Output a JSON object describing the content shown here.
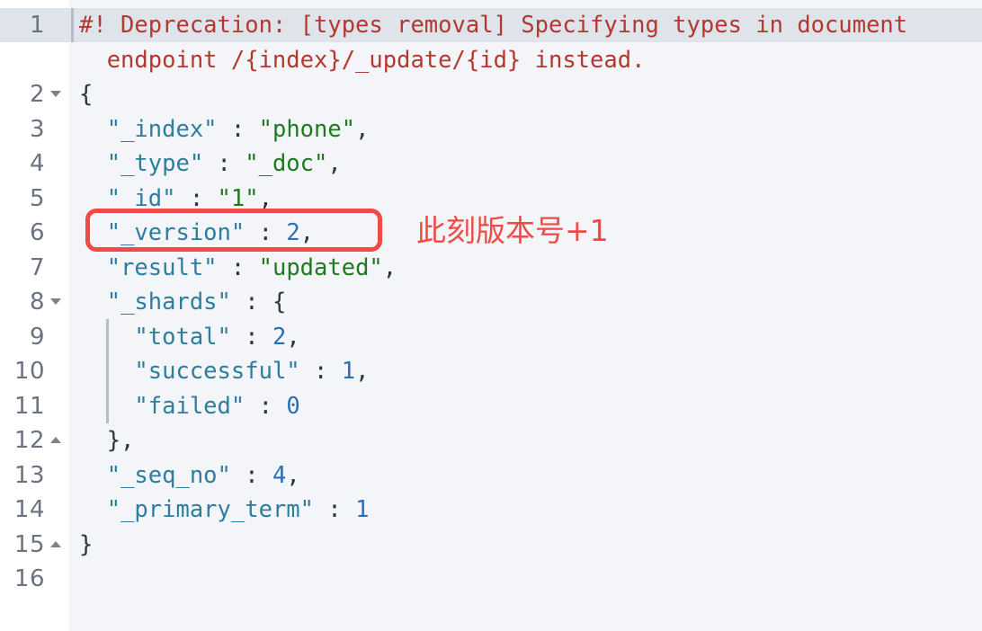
{
  "editor": {
    "language": "json",
    "background": "#f4f5f9",
    "gutter_background": "#ffffff",
    "active_line_background": "#dfe3ea",
    "total_lines": 16,
    "active_line": 1,
    "lines": [
      {
        "number": "1",
        "fold": "",
        "active": true,
        "segments": [
          {
            "text": "#! Deprecation: [types removal] Specifying types in document",
            "cls": "warn"
          }
        ]
      },
      {
        "number": "",
        "fold": "",
        "active": false,
        "segments": [
          {
            "text": "  endpoint /{index}/_update/{id} instead.",
            "cls": "warn"
          }
        ]
      },
      {
        "number": "2",
        "fold": "down",
        "active": false,
        "segments": [
          {
            "text": "{",
            "cls": "pun"
          }
        ]
      },
      {
        "number": "3",
        "fold": "",
        "active": false,
        "segments": [
          {
            "text": "  ",
            "cls": "pun"
          },
          {
            "text": "\"_index\"",
            "cls": "k"
          },
          {
            "text": " : ",
            "cls": "pun"
          },
          {
            "text": "\"phone\"",
            "cls": "str"
          },
          {
            "text": ",",
            "cls": "pun"
          }
        ]
      },
      {
        "number": "4",
        "fold": "",
        "active": false,
        "segments": [
          {
            "text": "  ",
            "cls": "pun"
          },
          {
            "text": "\"_type\"",
            "cls": "k"
          },
          {
            "text": " : ",
            "cls": "pun"
          },
          {
            "text": "\"_doc\"",
            "cls": "str"
          },
          {
            "text": ",",
            "cls": "pun"
          }
        ]
      },
      {
        "number": "5",
        "fold": "",
        "active": false,
        "segments": [
          {
            "text": "  ",
            "cls": "pun"
          },
          {
            "text": "\"_id\"",
            "cls": "k"
          },
          {
            "text": " : ",
            "cls": "pun"
          },
          {
            "text": "\"1\"",
            "cls": "str"
          },
          {
            "text": ",",
            "cls": "pun"
          }
        ]
      },
      {
        "number": "6",
        "fold": "",
        "active": false,
        "segments": [
          {
            "text": "  ",
            "cls": "pun"
          },
          {
            "text": "\"_version\"",
            "cls": "k"
          },
          {
            "text": " : ",
            "cls": "pun"
          },
          {
            "text": "2",
            "cls": "num"
          },
          {
            "text": ",",
            "cls": "pun"
          }
        ]
      },
      {
        "number": "7",
        "fold": "",
        "active": false,
        "segments": [
          {
            "text": "  ",
            "cls": "pun"
          },
          {
            "text": "\"result\"",
            "cls": "k"
          },
          {
            "text": " : ",
            "cls": "pun"
          },
          {
            "text": "\"updated\"",
            "cls": "str"
          },
          {
            "text": ",",
            "cls": "pun"
          }
        ]
      },
      {
        "number": "8",
        "fold": "down",
        "active": false,
        "segments": [
          {
            "text": "  ",
            "cls": "pun"
          },
          {
            "text": "\"_shards\"",
            "cls": "k"
          },
          {
            "text": " : ",
            "cls": "pun"
          },
          {
            "text": "{",
            "cls": "pun"
          }
        ]
      },
      {
        "number": "9",
        "fold": "",
        "active": false,
        "segments": [
          {
            "text": "    ",
            "cls": "pun"
          },
          {
            "text": "\"total\"",
            "cls": "k"
          },
          {
            "text": " : ",
            "cls": "pun"
          },
          {
            "text": "2",
            "cls": "num"
          },
          {
            "text": ",",
            "cls": "pun"
          }
        ]
      },
      {
        "number": "10",
        "fold": "",
        "active": false,
        "segments": [
          {
            "text": "    ",
            "cls": "pun"
          },
          {
            "text": "\"successful\"",
            "cls": "k"
          },
          {
            "text": " : ",
            "cls": "pun"
          },
          {
            "text": "1",
            "cls": "num"
          },
          {
            "text": ",",
            "cls": "pun"
          }
        ]
      },
      {
        "number": "11",
        "fold": "",
        "active": false,
        "segments": [
          {
            "text": "    ",
            "cls": "pun"
          },
          {
            "text": "\"failed\"",
            "cls": "k"
          },
          {
            "text": " : ",
            "cls": "pun"
          },
          {
            "text": "0",
            "cls": "num"
          }
        ]
      },
      {
        "number": "12",
        "fold": "up",
        "active": false,
        "segments": [
          {
            "text": "  },",
            "cls": "pun"
          }
        ]
      },
      {
        "number": "13",
        "fold": "",
        "active": false,
        "segments": [
          {
            "text": "  ",
            "cls": "pun"
          },
          {
            "text": "\"_seq_no\"",
            "cls": "k"
          },
          {
            "text": " : ",
            "cls": "pun"
          },
          {
            "text": "4",
            "cls": "num"
          },
          {
            "text": ",",
            "cls": "pun"
          }
        ]
      },
      {
        "number": "14",
        "fold": "",
        "active": false,
        "segments": [
          {
            "text": "  ",
            "cls": "pun"
          },
          {
            "text": "\"_primary_term\"",
            "cls": "k"
          },
          {
            "text": " : ",
            "cls": "pun"
          },
          {
            "text": "1",
            "cls": "num"
          }
        ]
      },
      {
        "number": "15",
        "fold": "up",
        "active": false,
        "segments": [
          {
            "text": "}",
            "cls": "pun"
          }
        ]
      },
      {
        "number": "16",
        "fold": "",
        "active": false,
        "segments": []
      }
    ]
  },
  "annotation": {
    "highlight_color": "#ef4a45",
    "note_text": "此刻版本号+1",
    "highlighted_line": "\"_version\" : 2,"
  }
}
